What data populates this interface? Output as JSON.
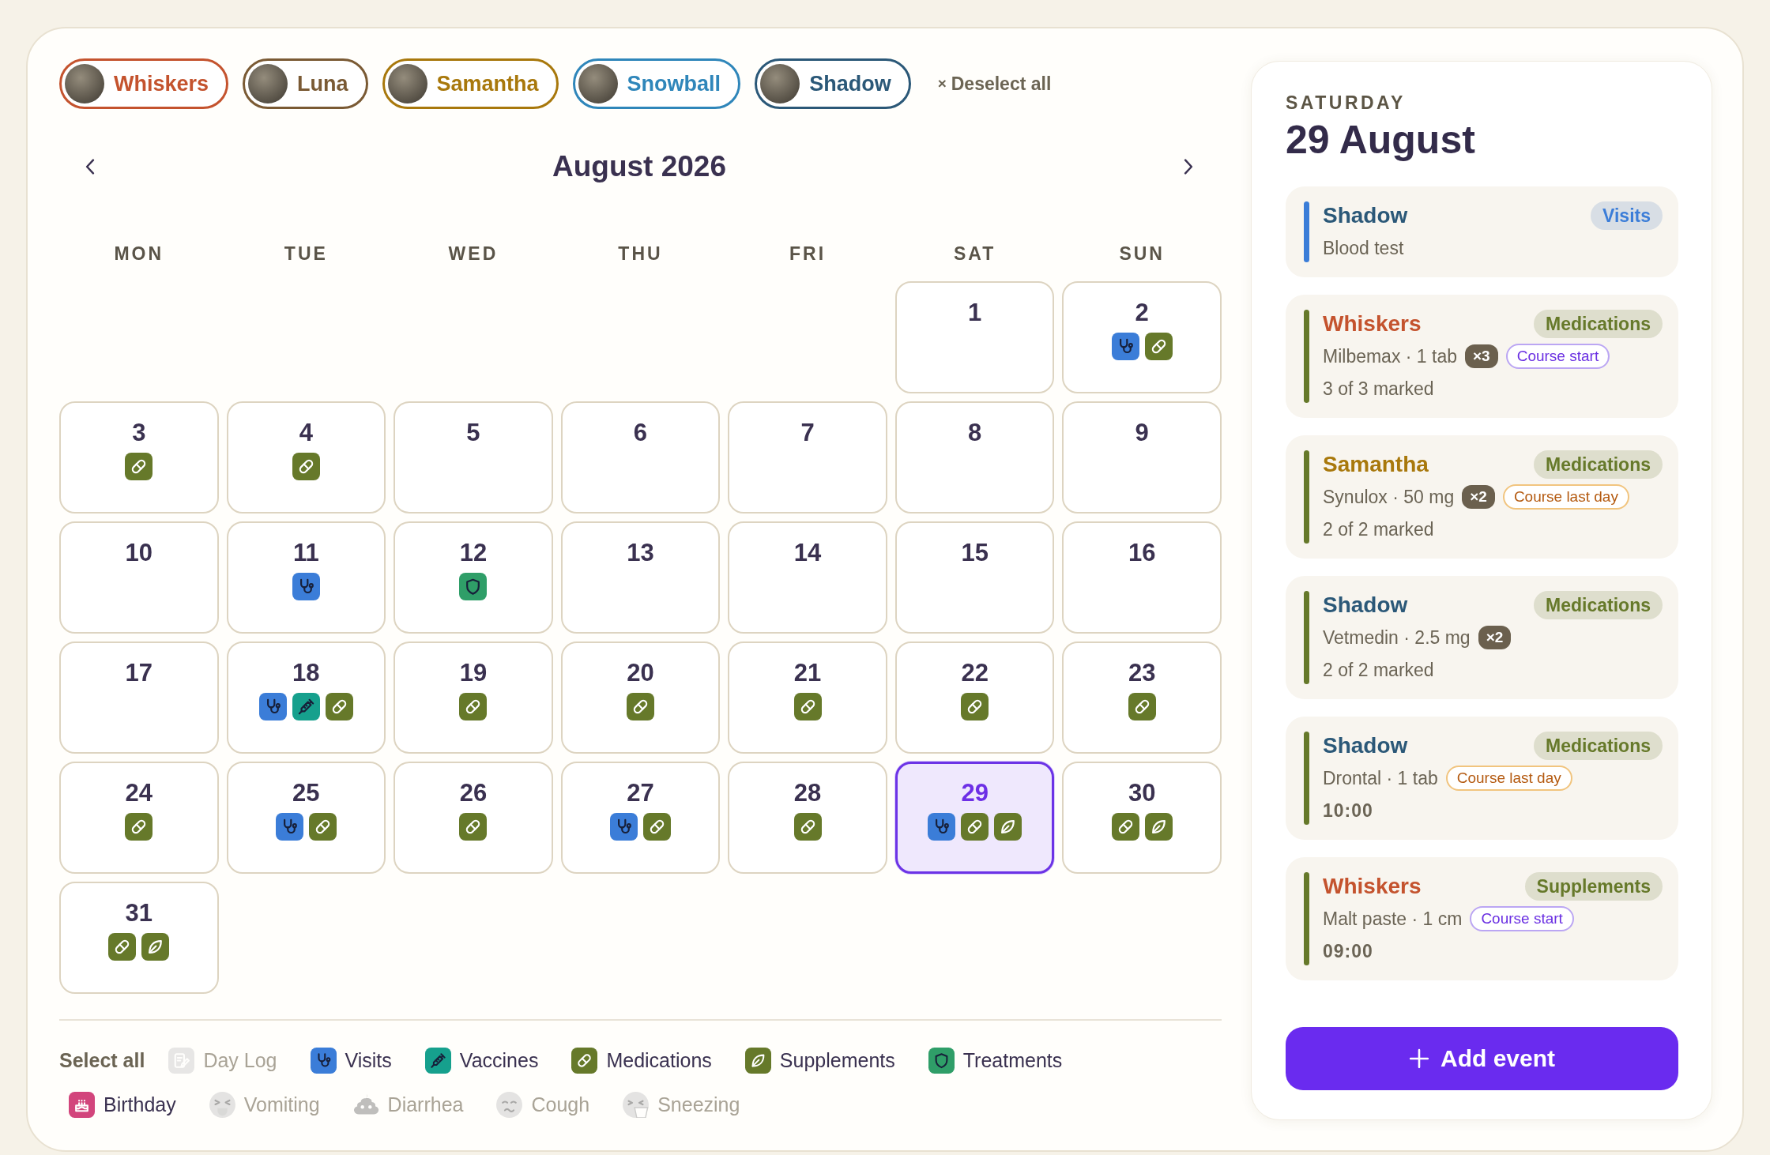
{
  "pets": [
    {
      "name": "Whiskers",
      "color": "#c4532e",
      "selected": true
    },
    {
      "name": "Luna",
      "color": "#7a5a34",
      "selected": true
    },
    {
      "name": "Samantha",
      "color": "#a8780c",
      "selected": true
    },
    {
      "name": "Snowball",
      "color": "#2f86ba",
      "selected": true
    },
    {
      "name": "Shadow",
      "color": "#2b5878",
      "selected": true
    }
  ],
  "deselect_all": {
    "icon": "×",
    "label": "Deselect all"
  },
  "calendar": {
    "title": "August 2026",
    "weekdays": [
      "MON",
      "TUE",
      "WED",
      "THU",
      "FRI",
      "SAT",
      "SUN"
    ],
    "weeks": [
      [
        {
          "day": "1",
          "selected": false
        },
        {
          "day": "2",
          "selected": false,
          "markers": [
            {
              "kind": "visit"
            },
            {
              "kind": "medication"
            }
          ]
        }
      ],
      [
        {
          "day": "3",
          "selected": false,
          "markers": [
            {
              "kind": "medication"
            }
          ]
        },
        {
          "day": "4",
          "selected": false,
          "markers": [
            {
              "kind": "medication"
            }
          ]
        },
        {
          "day": "5",
          "selected": false
        },
        {
          "day": "6",
          "selected": false
        },
        {
          "day": "7",
          "selected": false
        },
        {
          "day": "8",
          "selected": false
        },
        {
          "day": "9",
          "selected": false
        }
      ],
      [
        {
          "day": "10",
          "selected": false
        },
        {
          "day": "11",
          "selected": false,
          "markers": [
            {
              "kind": "visit"
            }
          ]
        },
        {
          "day": "12",
          "selected": false,
          "markers": [
            {
              "kind": "treatment"
            }
          ]
        },
        {
          "day": "13",
          "selected": false
        },
        {
          "day": "14",
          "selected": false
        },
        {
          "day": "15",
          "selected": false
        },
        {
          "day": "16",
          "selected": false
        }
      ],
      [
        {
          "day": "17",
          "selected": false
        },
        {
          "day": "18",
          "selected": false,
          "markers": [
            {
              "kind": "visit"
            },
            {
              "kind": "vaccine"
            },
            {
              "kind": "medication"
            }
          ]
        },
        {
          "day": "19",
          "selected": false,
          "markers": [
            {
              "kind": "medication"
            }
          ]
        },
        {
          "day": "20",
          "selected": false,
          "markers": [
            {
              "kind": "medication"
            }
          ]
        },
        {
          "day": "21",
          "selected": false,
          "markers": [
            {
              "kind": "medication"
            }
          ]
        },
        {
          "day": "22",
          "selected": false,
          "markers": [
            {
              "kind": "medication"
            }
          ]
        },
        {
          "day": "23",
          "selected": false,
          "markers": [
            {
              "kind": "medication"
            }
          ]
        }
      ],
      [
        {
          "day": "24",
          "selected": false,
          "markers": [
            {
              "kind": "medication"
            }
          ]
        },
        {
          "day": "25",
          "selected": false,
          "markers": [
            {
              "kind": "visit"
            },
            {
              "kind": "medication"
            }
          ]
        },
        {
          "day": "26",
          "selected": false,
          "markers": [
            {
              "kind": "medication"
            }
          ]
        },
        {
          "day": "27",
          "selected": false,
          "markers": [
            {
              "kind": "visit"
            },
            {
              "kind": "medication"
            }
          ]
        },
        {
          "day": "28",
          "selected": false,
          "markers": [
            {
              "kind": "medication"
            }
          ]
        },
        {
          "day": "29",
          "selected": true,
          "markers": [
            {
              "kind": "visit"
            },
            {
              "kind": "medication"
            },
            {
              "kind": "supplement"
            }
          ]
        },
        {
          "day": "30",
          "selected": false,
          "markers": [
            {
              "kind": "medication"
            },
            {
              "kind": "supplement"
            }
          ]
        }
      ],
      [
        {
          "day": "31",
          "selected": false,
          "markers": [
            {
              "kind": "medication"
            },
            {
              "kind": "supplement"
            }
          ]
        }
      ]
    ]
  },
  "legend": {
    "select_all": "Select all",
    "categories": [
      {
        "label": "Day Log",
        "kind": "day-log",
        "selected": false
      },
      {
        "label": "Visits",
        "kind": "visit",
        "color": "#3b7dd8",
        "selected": true
      },
      {
        "label": "Vaccines",
        "kind": "vaccine",
        "color": "#16a08d",
        "selected": true
      },
      {
        "label": "Medications",
        "kind": "medication",
        "color": "#66792a",
        "selected": true
      },
      {
        "label": "Supplements",
        "kind": "supplement",
        "color": "#66792a",
        "selected": true
      },
      {
        "label": "Treatments",
        "kind": "treatment",
        "color": "#2f9e68",
        "selected": true
      },
      {
        "label": "Birthday",
        "kind": "birthday",
        "color": "#d2457c",
        "selected": true
      },
      {
        "label": "Vomiting",
        "kind": "vomiting",
        "selected": false
      },
      {
        "label": "Diarrhea",
        "kind": "diarrhea",
        "selected": false
      },
      {
        "label": "Cough",
        "kind": "cough",
        "selected": false
      },
      {
        "label": "Sneezing",
        "kind": "sneezing",
        "selected": false
      }
    ]
  },
  "day_panel": {
    "weekday": "SATURDAY",
    "date": "29 August",
    "events": [
      {
        "pet": "Shadow",
        "color": "#2b5878",
        "kind": "visit",
        "category": "Visits",
        "detail": "Blood test"
      },
      {
        "pet": "Whiskers",
        "color": "#c4532e",
        "kind": "medication",
        "category": "Medications",
        "detail": "Milbemax · 1 tab",
        "count": "×3",
        "tag": {
          "label": "Course start",
          "kind": "start"
        },
        "marked": "3 of 3 marked"
      },
      {
        "pet": "Samantha",
        "color": "#a8780c",
        "kind": "medication",
        "category": "Medications",
        "detail": "Synulox · 50 mg",
        "count": "×2",
        "tag": {
          "label": "Course last day",
          "kind": "end"
        },
        "marked": "2 of 2 marked"
      },
      {
        "pet": "Shadow",
        "color": "#2b5878",
        "kind": "medication",
        "category": "Medications",
        "detail": "Vetmedin · 2.5 mg",
        "count": "×2",
        "marked": "2 of 2 marked"
      },
      {
        "pet": "Shadow",
        "color": "#2b5878",
        "kind": "medication",
        "category": "Medications",
        "detail": "Drontal · 1 tab",
        "tag": {
          "label": "Course last day",
          "kind": "end"
        },
        "time": "10:00"
      },
      {
        "pet": "Whiskers",
        "color": "#c4532e",
        "kind": "supplement",
        "category": "Supplements",
        "detail": "Malt paste · 1 cm",
        "tag": {
          "label": "Course start",
          "kind": "start"
        },
        "time": "09:00"
      }
    ],
    "add_button": "Add event"
  }
}
